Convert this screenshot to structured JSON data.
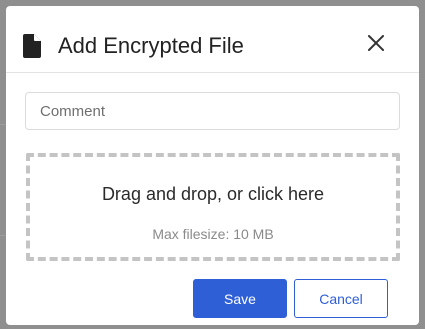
{
  "dialog": {
    "title": "Add Encrypted File",
    "title_icon": "file-icon",
    "close_icon": "close-icon"
  },
  "comment": {
    "placeholder": "Comment",
    "value": ""
  },
  "dropzone": {
    "text": "Drag and drop, or click here",
    "hint": "Max filesize: 10 MB"
  },
  "actions": {
    "save_label": "Save",
    "cancel_label": "Cancel"
  },
  "colors": {
    "accent": "#2f5fd6",
    "overlay": "#8f8f8f"
  }
}
